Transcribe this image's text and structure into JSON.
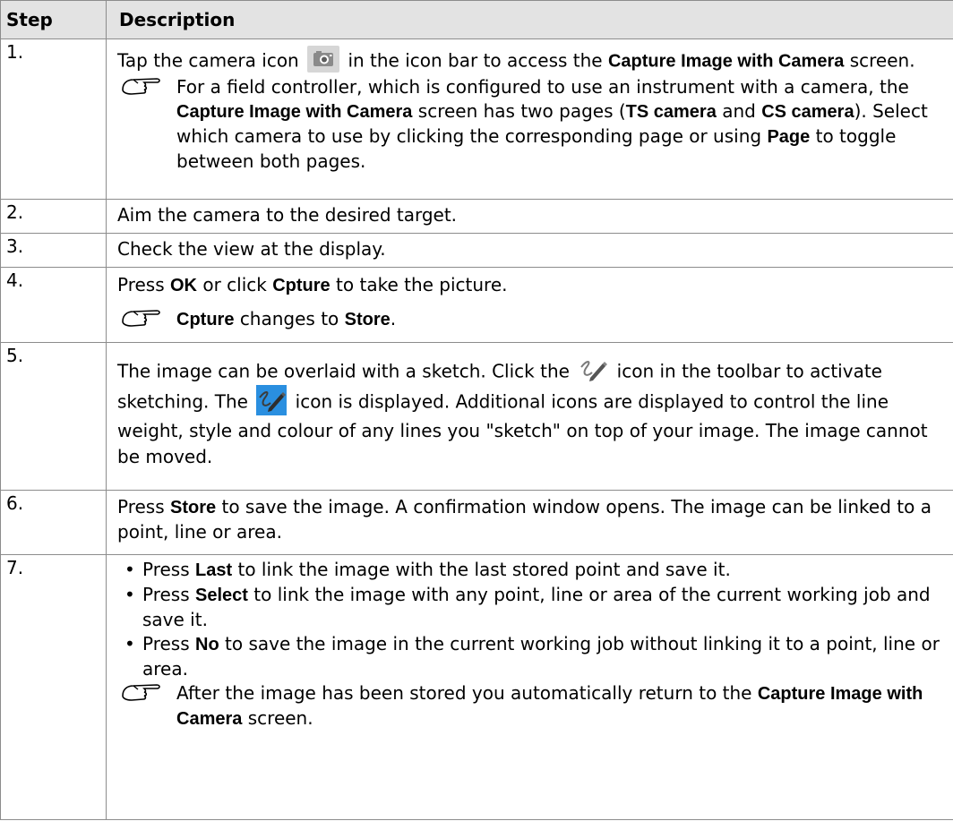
{
  "header": {
    "step": "Step",
    "description": "Description"
  },
  "rows": {
    "r1": {
      "step": "1.",
      "a": "Tap the camera icon",
      "b": "in the icon bar to access the",
      "c": "Capture Image with Camera",
      "d": "screen.",
      "note": {
        "a": "For a field controller, which is configured to use an instrument with a camera, the",
        "b": "Capture Image with Camera",
        "c": "screen has two pages (",
        "d": "TS camera",
        "e": "and",
        "f": "CS camera",
        "g": "). Select which camera to use by clicking the corresponding page or using",
        "h": "Page",
        "i": "to toggle between both pages."
      }
    },
    "r2": {
      "step": "2.",
      "text": "Aim the camera to the desired target."
    },
    "r3": {
      "step": "3.",
      "text": "Check the view at the display."
    },
    "r4": {
      "step": "4.",
      "a": "Press",
      "b": "OK",
      "c": "or click",
      "d": "Cpture",
      "e": "to take the picture.",
      "note": {
        "a": "Cpture",
        "b": "changes to",
        "c": "Store",
        "d": "."
      }
    },
    "r5": {
      "step": "5.",
      "a": "The image can be overlaid with a sketch. Click the",
      "b": "icon in the toolbar to activate sketching. The",
      "c": "icon is displayed. Additional icons are displayed to control the line weight, style and colour of any lines you \"sketch\" on top of your image. The image cannot be moved."
    },
    "r6": {
      "step": "6.",
      "a": "Press",
      "b": "Store",
      "c": "to save the image. A confirmation window opens. The image can be linked to a point, line or area."
    },
    "r7": {
      "step": "7.",
      "bullets": {
        "b1": {
          "a": "Press",
          "b": "Last",
          "c": "to link the image with the last stored point and save it."
        },
        "b2": {
          "a": "Press",
          "b": "Select",
          "c": "to link the image with any point, line or area of the current working job and save it."
        },
        "b3": {
          "a": "Press",
          "b": "No",
          "c": "to save the image in the current working job without linking it to a point, line or area."
        }
      },
      "note": {
        "a": "After the image has been stored you automatically return to the",
        "b": "Capture Image with Camera",
        "c": "screen."
      }
    }
  }
}
